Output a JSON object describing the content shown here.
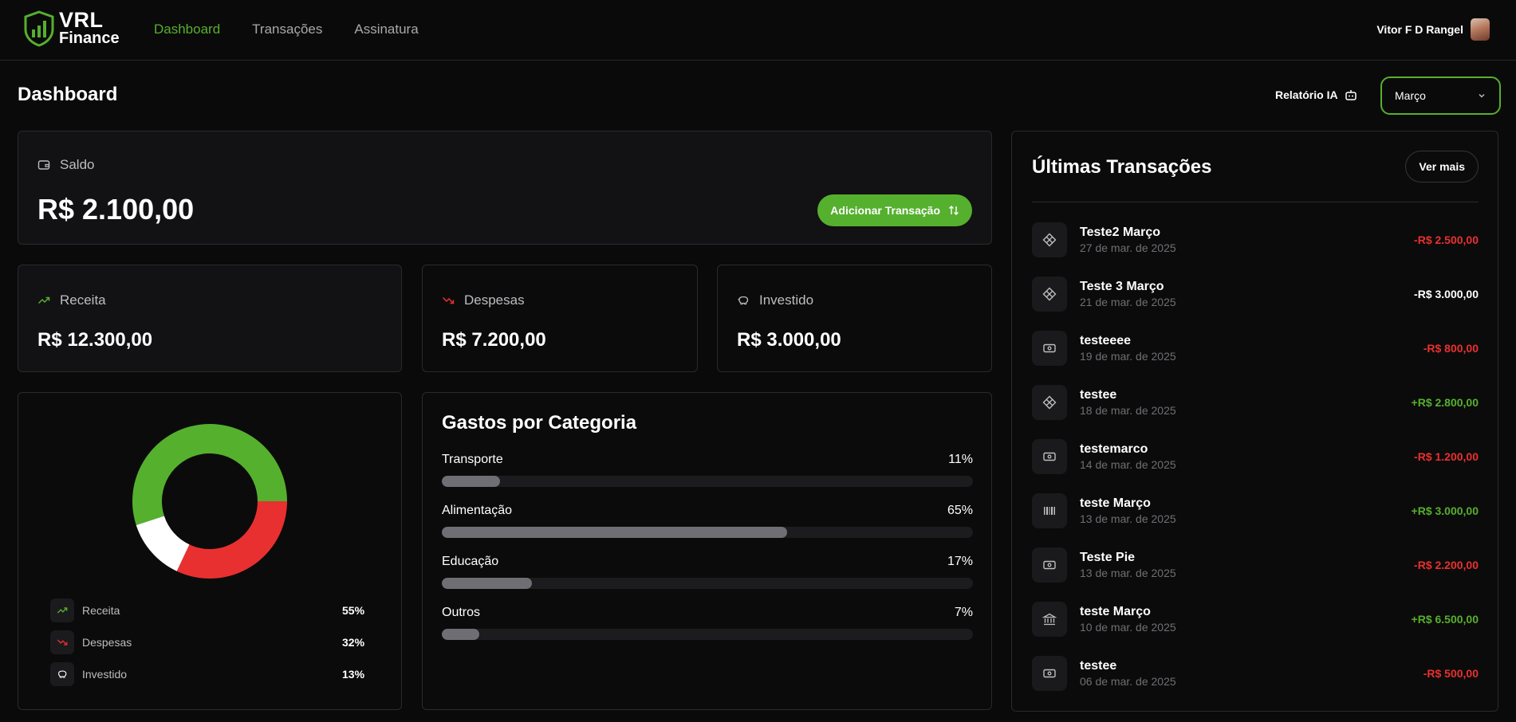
{
  "nav": {
    "logo_line1": "VRL",
    "logo_line2": "Finance",
    "links": [
      "Dashboard",
      "Transações",
      "Assinatura"
    ],
    "user_name": "Vitor F D Rangel"
  },
  "header": {
    "title": "Dashboard",
    "ai_report": "Relatório IA",
    "month": "Março"
  },
  "balance": {
    "label": "Saldo",
    "value": "R$ 2.100,00",
    "add_button": "Adicionar Transação"
  },
  "summary": [
    {
      "label": "Receita",
      "value": "R$ 12.300,00"
    },
    {
      "label": "Despesas",
      "value": "R$ 7.200,00"
    },
    {
      "label": "Investido",
      "value": "R$ 3.000,00"
    }
  ],
  "chart_data": {
    "type": "pie",
    "categories": [
      "Receita",
      "Despesas",
      "Investido"
    ],
    "values": [
      55,
      32,
      13
    ],
    "colors": [
      "#55b02e",
      "#e93030",
      "#ffffff"
    ]
  },
  "legend": [
    {
      "label": "Receita",
      "pct": "55%"
    },
    {
      "label": "Despesas",
      "pct": "32%"
    },
    {
      "label": "Investido",
      "pct": "13%"
    }
  ],
  "categories": {
    "title": "Gastos por Categoria",
    "items": [
      {
        "name": "Transporte",
        "pct_label": "11%",
        "pct": 11
      },
      {
        "name": "Alimentação",
        "pct_label": "65%",
        "pct": 65
      },
      {
        "name": "Educação",
        "pct_label": "17%",
        "pct": 17
      },
      {
        "name": "Outros",
        "pct_label": "7%",
        "pct": 7
      }
    ]
  },
  "transactions": {
    "title": "Últimas Transações",
    "see_more": "Ver mais",
    "items": [
      {
        "name": "Teste2 Março",
        "date": "27 de mar. de 2025",
        "amount": "-R$ 2.500,00",
        "tone": "neg",
        "icon": "pix-icon"
      },
      {
        "name": "Teste 3 Março",
        "date": "21 de mar. de 2025",
        "amount": "-R$ 3.000,00",
        "tone": "neu",
        "icon": "pix-icon"
      },
      {
        "name": "testeeee",
        "date": "19 de mar. de 2025",
        "amount": "-R$ 800,00",
        "tone": "neg",
        "icon": "cash-icon"
      },
      {
        "name": "testee",
        "date": "18 de mar. de 2025",
        "amount": "+R$ 2.800,00",
        "tone": "pos",
        "icon": "pix-icon"
      },
      {
        "name": "testemarco",
        "date": "14 de mar. de 2025",
        "amount": "-R$ 1.200,00",
        "tone": "neg",
        "icon": "cash-icon"
      },
      {
        "name": "teste Março",
        "date": "13 de mar. de 2025",
        "amount": "+R$ 3.000,00",
        "tone": "pos",
        "icon": "barcode-icon"
      },
      {
        "name": "Teste Pie",
        "date": "13 de mar. de 2025",
        "amount": "-R$ 2.200,00",
        "tone": "neg",
        "icon": "cash-icon"
      },
      {
        "name": "teste Março",
        "date": "10 de mar. de 2025",
        "amount": "+R$ 6.500,00",
        "tone": "pos",
        "icon": "bank-icon"
      },
      {
        "name": "testee",
        "date": "06 de mar. de 2025",
        "amount": "-R$ 500,00",
        "tone": "neg",
        "icon": "cash-icon"
      }
    ]
  }
}
